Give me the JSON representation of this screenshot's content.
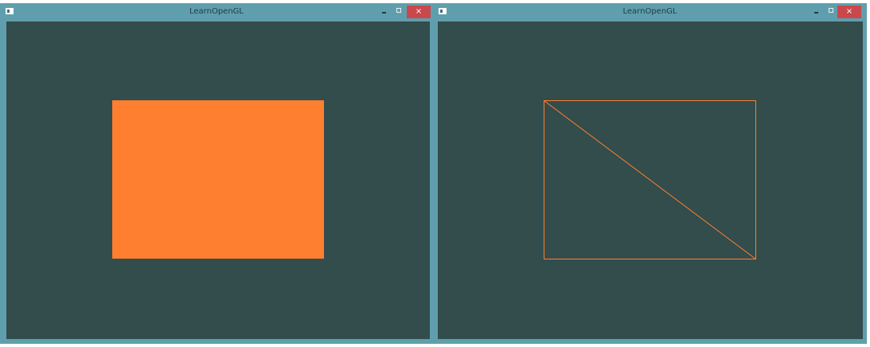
{
  "windows": [
    {
      "title": "LearnOpenGL",
      "close_label": "×",
      "clear_color": "#334c4c",
      "render_mode": "fill",
      "shape_color": "#ff7f30"
    },
    {
      "title": "LearnOpenGL",
      "close_label": "×",
      "clear_color": "#334c4c",
      "render_mode": "wireframe",
      "shape_color": "#ff7f30"
    }
  ],
  "frame_color": "#5f9fad",
  "close_button_color": "#c9484c"
}
